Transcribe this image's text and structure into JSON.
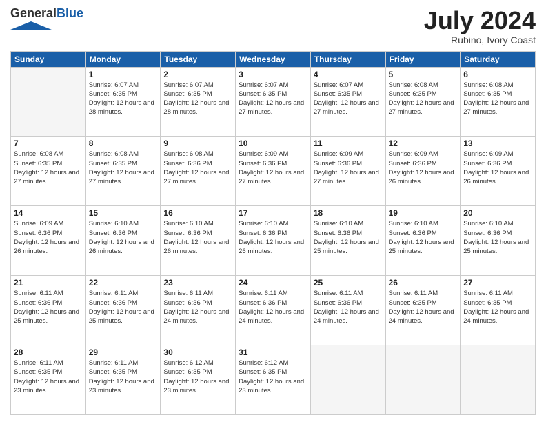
{
  "header": {
    "logo_general": "General",
    "logo_blue": "Blue",
    "month_title": "July 2024",
    "location": "Rubino, Ivory Coast"
  },
  "days_of_week": [
    "Sunday",
    "Monday",
    "Tuesday",
    "Wednesday",
    "Thursday",
    "Friday",
    "Saturday"
  ],
  "weeks": [
    [
      {
        "day": "",
        "empty": true
      },
      {
        "day": "1",
        "sunrise": "Sunrise: 6:07 AM",
        "sunset": "Sunset: 6:35 PM",
        "daylight": "Daylight: 12 hours and 28 minutes."
      },
      {
        "day": "2",
        "sunrise": "Sunrise: 6:07 AM",
        "sunset": "Sunset: 6:35 PM",
        "daylight": "Daylight: 12 hours and 28 minutes."
      },
      {
        "day": "3",
        "sunrise": "Sunrise: 6:07 AM",
        "sunset": "Sunset: 6:35 PM",
        "daylight": "Daylight: 12 hours and 27 minutes."
      },
      {
        "day": "4",
        "sunrise": "Sunrise: 6:07 AM",
        "sunset": "Sunset: 6:35 PM",
        "daylight": "Daylight: 12 hours and 27 minutes."
      },
      {
        "day": "5",
        "sunrise": "Sunrise: 6:08 AM",
        "sunset": "Sunset: 6:35 PM",
        "daylight": "Daylight: 12 hours and 27 minutes."
      },
      {
        "day": "6",
        "sunrise": "Sunrise: 6:08 AM",
        "sunset": "Sunset: 6:35 PM",
        "daylight": "Daylight: 12 hours and 27 minutes."
      }
    ],
    [
      {
        "day": "7",
        "sunrise": "Sunrise: 6:08 AM",
        "sunset": "Sunset: 6:35 PM",
        "daylight": "Daylight: 12 hours and 27 minutes."
      },
      {
        "day": "8",
        "sunrise": "Sunrise: 6:08 AM",
        "sunset": "Sunset: 6:35 PM",
        "daylight": "Daylight: 12 hours and 27 minutes."
      },
      {
        "day": "9",
        "sunrise": "Sunrise: 6:08 AM",
        "sunset": "Sunset: 6:36 PM",
        "daylight": "Daylight: 12 hours and 27 minutes."
      },
      {
        "day": "10",
        "sunrise": "Sunrise: 6:09 AM",
        "sunset": "Sunset: 6:36 PM",
        "daylight": "Daylight: 12 hours and 27 minutes."
      },
      {
        "day": "11",
        "sunrise": "Sunrise: 6:09 AM",
        "sunset": "Sunset: 6:36 PM",
        "daylight": "Daylight: 12 hours and 27 minutes."
      },
      {
        "day": "12",
        "sunrise": "Sunrise: 6:09 AM",
        "sunset": "Sunset: 6:36 PM",
        "daylight": "Daylight: 12 hours and 26 minutes."
      },
      {
        "day": "13",
        "sunrise": "Sunrise: 6:09 AM",
        "sunset": "Sunset: 6:36 PM",
        "daylight": "Daylight: 12 hours and 26 minutes."
      }
    ],
    [
      {
        "day": "14",
        "sunrise": "Sunrise: 6:09 AM",
        "sunset": "Sunset: 6:36 PM",
        "daylight": "Daylight: 12 hours and 26 minutes."
      },
      {
        "day": "15",
        "sunrise": "Sunrise: 6:10 AM",
        "sunset": "Sunset: 6:36 PM",
        "daylight": "Daylight: 12 hours and 26 minutes."
      },
      {
        "day": "16",
        "sunrise": "Sunrise: 6:10 AM",
        "sunset": "Sunset: 6:36 PM",
        "daylight": "Daylight: 12 hours and 26 minutes."
      },
      {
        "day": "17",
        "sunrise": "Sunrise: 6:10 AM",
        "sunset": "Sunset: 6:36 PM",
        "daylight": "Daylight: 12 hours and 26 minutes."
      },
      {
        "day": "18",
        "sunrise": "Sunrise: 6:10 AM",
        "sunset": "Sunset: 6:36 PM",
        "daylight": "Daylight: 12 hours and 25 minutes."
      },
      {
        "day": "19",
        "sunrise": "Sunrise: 6:10 AM",
        "sunset": "Sunset: 6:36 PM",
        "daylight": "Daylight: 12 hours and 25 minutes."
      },
      {
        "day": "20",
        "sunrise": "Sunrise: 6:10 AM",
        "sunset": "Sunset: 6:36 PM",
        "daylight": "Daylight: 12 hours and 25 minutes."
      }
    ],
    [
      {
        "day": "21",
        "sunrise": "Sunrise: 6:11 AM",
        "sunset": "Sunset: 6:36 PM",
        "daylight": "Daylight: 12 hours and 25 minutes."
      },
      {
        "day": "22",
        "sunrise": "Sunrise: 6:11 AM",
        "sunset": "Sunset: 6:36 PM",
        "daylight": "Daylight: 12 hours and 25 minutes."
      },
      {
        "day": "23",
        "sunrise": "Sunrise: 6:11 AM",
        "sunset": "Sunset: 6:36 PM",
        "daylight": "Daylight: 12 hours and 24 minutes."
      },
      {
        "day": "24",
        "sunrise": "Sunrise: 6:11 AM",
        "sunset": "Sunset: 6:36 PM",
        "daylight": "Daylight: 12 hours and 24 minutes."
      },
      {
        "day": "25",
        "sunrise": "Sunrise: 6:11 AM",
        "sunset": "Sunset: 6:36 PM",
        "daylight": "Daylight: 12 hours and 24 minutes."
      },
      {
        "day": "26",
        "sunrise": "Sunrise: 6:11 AM",
        "sunset": "Sunset: 6:35 PM",
        "daylight": "Daylight: 12 hours and 24 minutes."
      },
      {
        "day": "27",
        "sunrise": "Sunrise: 6:11 AM",
        "sunset": "Sunset: 6:35 PM",
        "daylight": "Daylight: 12 hours and 24 minutes."
      }
    ],
    [
      {
        "day": "28",
        "sunrise": "Sunrise: 6:11 AM",
        "sunset": "Sunset: 6:35 PM",
        "daylight": "Daylight: 12 hours and 23 minutes."
      },
      {
        "day": "29",
        "sunrise": "Sunrise: 6:11 AM",
        "sunset": "Sunset: 6:35 PM",
        "daylight": "Daylight: 12 hours and 23 minutes."
      },
      {
        "day": "30",
        "sunrise": "Sunrise: 6:12 AM",
        "sunset": "Sunset: 6:35 PM",
        "daylight": "Daylight: 12 hours and 23 minutes."
      },
      {
        "day": "31",
        "sunrise": "Sunrise: 6:12 AM",
        "sunset": "Sunset: 6:35 PM",
        "daylight": "Daylight: 12 hours and 23 minutes."
      },
      {
        "day": "",
        "empty": true
      },
      {
        "day": "",
        "empty": true
      },
      {
        "day": "",
        "empty": true
      }
    ]
  ]
}
